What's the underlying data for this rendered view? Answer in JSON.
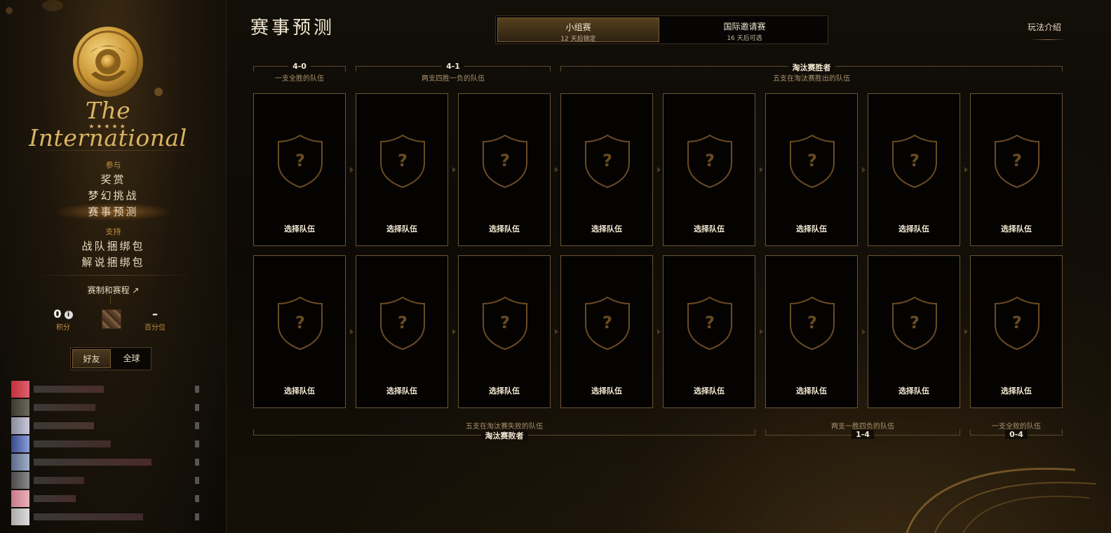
{
  "sidebar": {
    "logo": {
      "line1": "The International",
      "stars": "★★★★★"
    },
    "nav": {
      "participate_label": "参与",
      "rewards": "奖赏",
      "fantasy": "梦幻挑战",
      "predictions": "赛事预测",
      "support_label": "支持",
      "team_bundles": "战队捆绑包",
      "caster_bundles": "解说捆绑包"
    },
    "schedule_link": "赛制和赛程 ↗",
    "stats": {
      "score": "0",
      "score_label": "积分",
      "percentile": "–",
      "percentile_label": "百分位"
    },
    "scope": {
      "friends": "好友",
      "global": "全球"
    }
  },
  "main": {
    "title": "赛事预测",
    "tabs": [
      {
        "label": "小组赛",
        "sub": "12 天后锁定"
      },
      {
        "label": "国际邀请赛",
        "sub": "16 天后可选"
      }
    ],
    "how_to_play": "玩法介绍",
    "top_groups": [
      {
        "label": "4-0",
        "sub": "一支全胜的队伍"
      },
      {
        "label": "4-1",
        "sub": "两支四胜一负的队伍"
      },
      {
        "label": "淘汰赛胜者",
        "sub": "五支在淘汰赛胜出的队伍"
      }
    ],
    "bottom_groups": [
      {
        "label": "淘汰赛败者",
        "sub": "五支在淘汰赛失败的队伍"
      },
      {
        "label": "1-4",
        "sub": "两支一胜四负的队伍"
      },
      {
        "label": "0-4",
        "sub": "一支全败的队伍"
      }
    ],
    "pick_label": "选择队伍",
    "unknown_glyph": "?"
  },
  "colors": {
    "gold": "#c49040",
    "border": "#6b5532",
    "text": "#f2e7d0"
  },
  "icons": [
    "logo-emblem-icon",
    "info-icon",
    "shield-placeholder-icon",
    "external-link-icon"
  ]
}
